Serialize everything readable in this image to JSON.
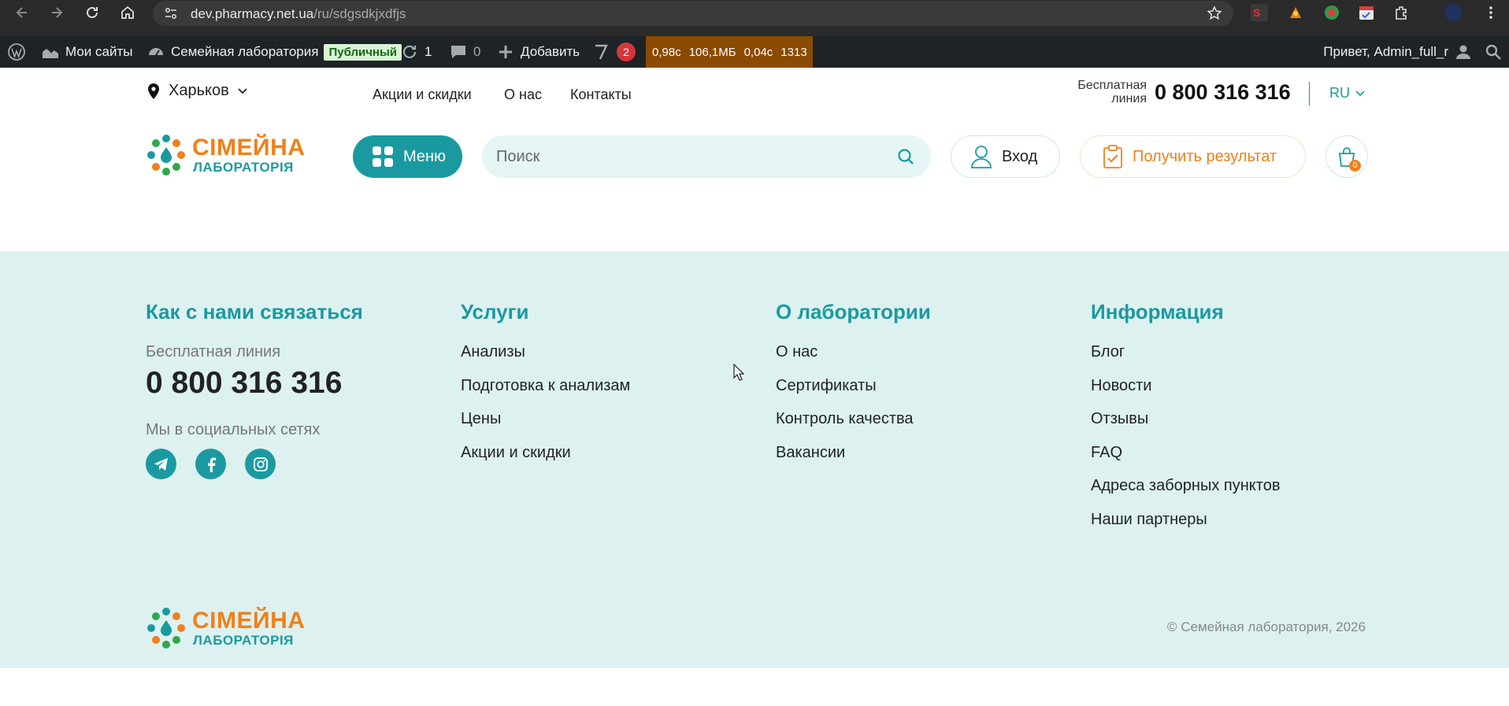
{
  "browser": {
    "url_host": "dev.pharmacy.net.ua",
    "url_path": "/ru/sdgsdkjxdfjs",
    "icons": [
      "back-icon",
      "forward-icon",
      "reload-icon",
      "home-icon",
      "site-info-icon",
      "bookmark-star-icon",
      "extensions-icon",
      "profile-icon",
      "more-icon"
    ]
  },
  "wpbar": {
    "my_sites": "Мои сайты",
    "site_name": "Семейная лаборатория",
    "public_badge": "Публичный",
    "updates_count": "1",
    "comments_count": "0",
    "add_new": "Добавить",
    "yoast_count": "2",
    "perf": {
      "time": "0,98с",
      "memory": "106,1МБ",
      "query_time": "0,04с",
      "queries": "1313"
    },
    "greeting": "Привет, Admin_full_r"
  },
  "header": {
    "city": "Харьков",
    "nav": [
      "Акции и скидки",
      "О нас",
      "Контакты"
    ],
    "free_line_label": "Бесплатная линия",
    "phone": "0 800 316 316",
    "language": "RU",
    "logo": {
      "line1": "СІМЕЙНА",
      "line2": "ЛАБОРАТОРІЯ"
    },
    "menu_label": "Меню",
    "search_placeholder": "Поиск",
    "login_label": "Вход",
    "result_label": "Получить результат",
    "cart_count": "0"
  },
  "footer": {
    "contact": {
      "title": "Как с нами связаться",
      "free_line": "Бесплатная линия",
      "phone": "0 800 316 316",
      "social_label": "Мы в социальных сетях",
      "socials": [
        "telegram-icon",
        "facebook-icon",
        "instagram-icon"
      ]
    },
    "services": {
      "title": "Услуги",
      "items": [
        "Анализы",
        "Подготовка к анализам",
        "Цены",
        "Акции и скидки"
      ]
    },
    "about": {
      "title": "О лаборатории",
      "items": [
        "О нас",
        "Сертификаты",
        "Контроль качества",
        "Вакансии"
      ]
    },
    "info": {
      "title": "Информация",
      "items": [
        "Блог",
        "Новости",
        "Отзывы",
        "FAQ",
        "Адреса заборных пунктов",
        "Наши партнеры"
      ]
    },
    "copyright": "© Семейная лаборатория, 2026"
  },
  "colors": {
    "brand_teal": "#1a9aa0",
    "brand_orange": "#f0801a",
    "footer_bg": "#ddf1f1",
    "wp_bar": "#1d2327"
  }
}
